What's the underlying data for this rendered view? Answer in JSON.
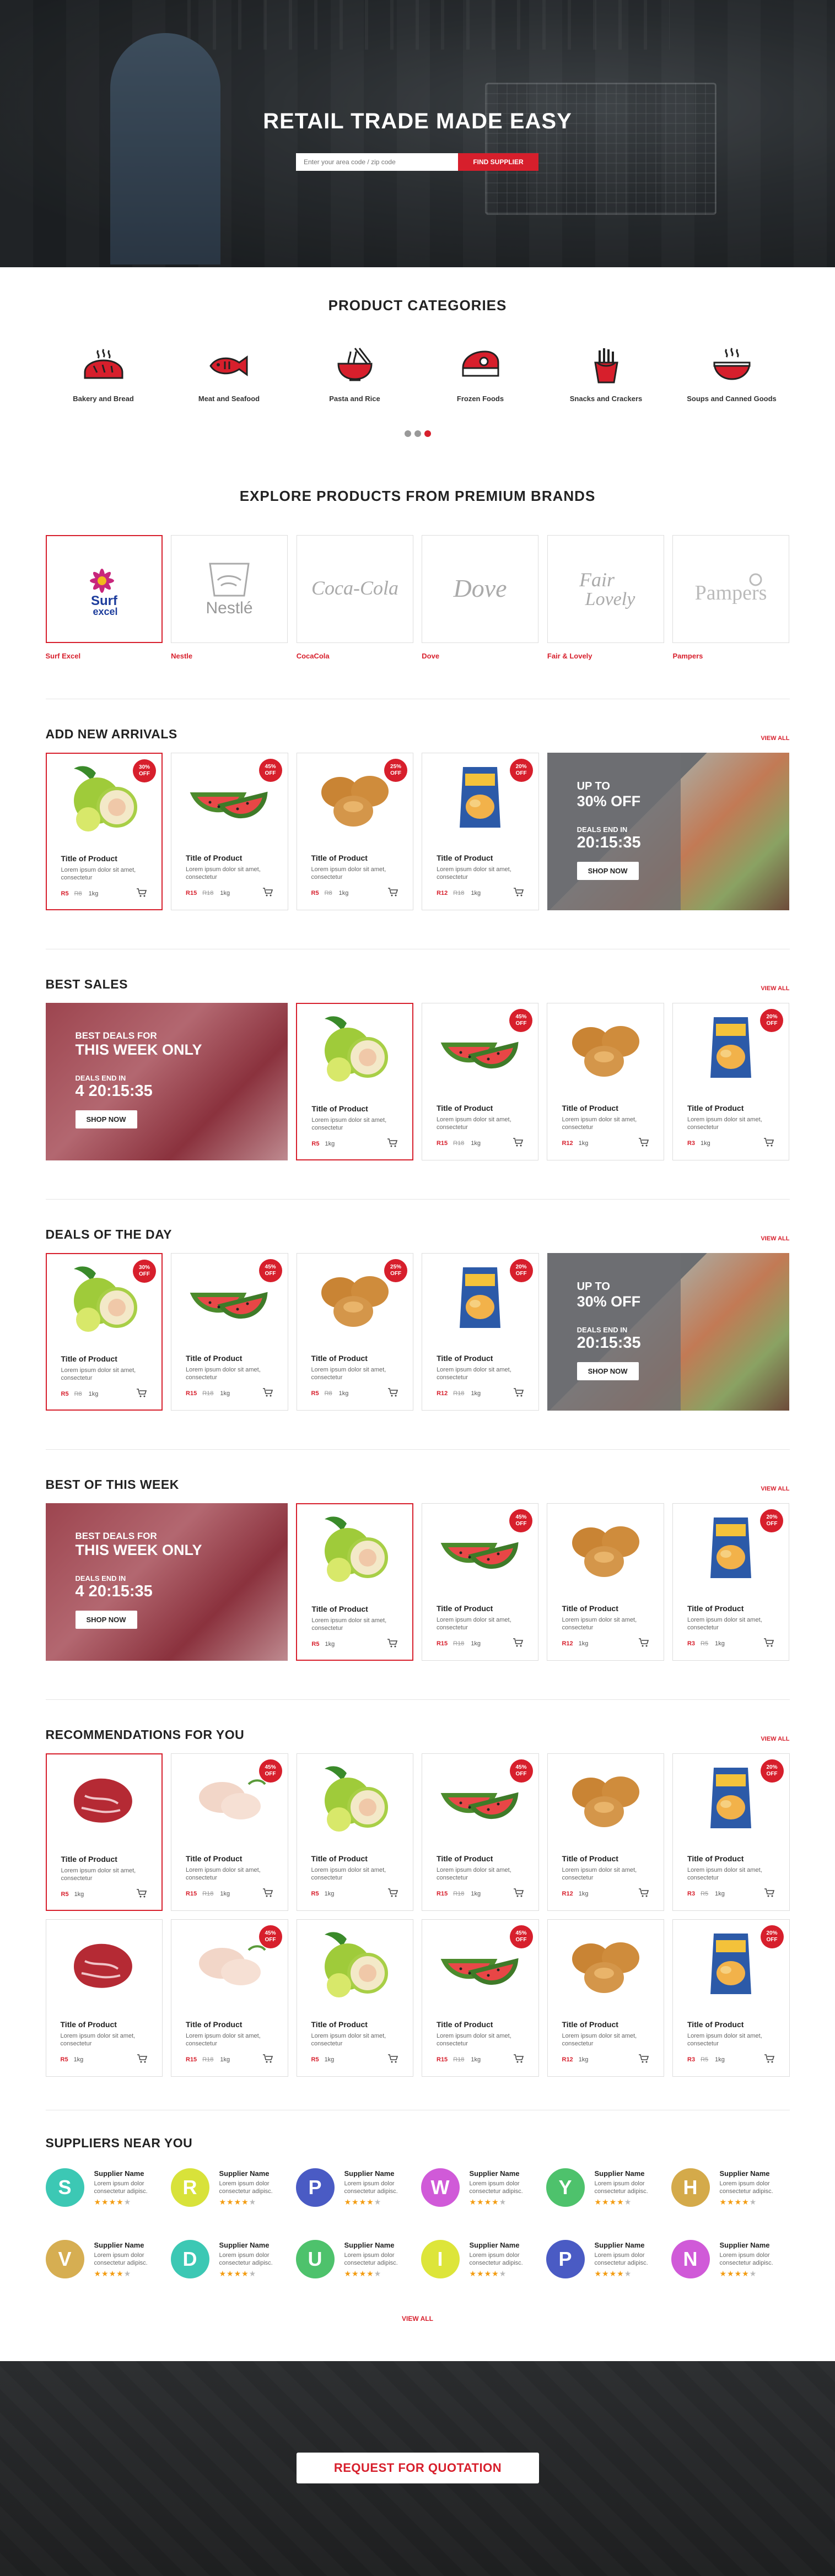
{
  "hero": {
    "title": "RETAIL TRADE MADE EASY",
    "search_placeholder": "Enter your area code / zip code",
    "search_button": "FIND SUPPLIER"
  },
  "categories": {
    "title": "PRODUCT CATEGORIES",
    "items": [
      {
        "label": "Bakery and Bread",
        "icon": "bread-icon"
      },
      {
        "label": "Meat and Seafood",
        "icon": "fish-icon"
      },
      {
        "label": "Pasta and Rice",
        "icon": "noodles-icon"
      },
      {
        "label": "Frozen Foods",
        "icon": "frozen-meat-icon"
      },
      {
        "label": "Snacks and Crackers",
        "icon": "fries-icon"
      },
      {
        "label": "Soups and Canned Goods",
        "icon": "soup-bowl-icon"
      }
    ]
  },
  "brands": {
    "title": "EXPLORE PRODUCTS FROM PREMIUM BRANDS",
    "items": [
      "Surf Excel",
      "Nestle",
      "CocaCola",
      "Dove",
      "Fair & Lovely",
      "Pampers"
    ],
    "logos": {
      "surf_a": "Surf",
      "surf_b": "excel",
      "nestle": "Nestlé",
      "coca": "Coca-Cola",
      "dove": "Dove",
      "fair_a": "Fair",
      "fair_b": "Lovely",
      "pampers": "Pampers"
    }
  },
  "common": {
    "title": "Title of Product",
    "desc": "Lorem ipsum dolor sit amet, consectetur",
    "weight": "1kg",
    "view_all": "VIEW ALL",
    "off": "OFF",
    "shop_now": "SHOP NOW"
  },
  "arrivals": {
    "title": "ADD NEW ARRIVALS",
    "products": [
      {
        "price": "R5",
        "old": "R8",
        "badge": "30%"
      },
      {
        "price": "R15",
        "old": "R18",
        "badge": "45%"
      },
      {
        "price": "R5",
        "old": "R8",
        "badge": "25%"
      },
      {
        "price": "R12",
        "old": "R18",
        "badge": "20%"
      }
    ],
    "promo": {
      "a": "UP TO",
      "b": "30% OFF",
      "c": "DEALS END IN",
      "e": "20:15:35"
    }
  },
  "best_sales": {
    "title": "BEST SALES",
    "promo": {
      "a": "BEST DEALS FOR",
      "b": "THIS WEEK ONLY",
      "c": "DEALS END IN",
      "e": "4  20:15:35"
    },
    "products": [
      {
        "price": "R5",
        "old": "",
        "badge": ""
      },
      {
        "price": "R15",
        "old": "R18",
        "badge": "45%"
      },
      {
        "price": "R12",
        "old": "",
        "badge": ""
      },
      {
        "price": "R3",
        "old": "",
        "badge": "20%"
      }
    ]
  },
  "deals": {
    "title": "DEALS OF THE DAY",
    "products": [
      {
        "price": "R5",
        "old": "R8",
        "badge": "30%"
      },
      {
        "price": "R15",
        "old": "R18",
        "badge": "45%"
      },
      {
        "price": "R5",
        "old": "R8",
        "badge": "25%"
      },
      {
        "price": "R12",
        "old": "R18",
        "badge": "20%"
      }
    ],
    "promo": {
      "a": "UP TO",
      "b": "30% OFF",
      "c": "DEALS END IN",
      "e": "20:15:35"
    }
  },
  "best_week": {
    "title": "BEST OF THIS WEEK",
    "promo": {
      "a": "BEST DEALS FOR",
      "b": "THIS WEEK ONLY",
      "c": "DEALS END IN",
      "e": "4  20:15:35"
    },
    "products": [
      {
        "price": "R5",
        "old": "",
        "badge": ""
      },
      {
        "price": "R15",
        "old": "R18",
        "badge": "45%"
      },
      {
        "price": "R12",
        "old": "",
        "badge": ""
      },
      {
        "price": "R3",
        "old": "R5",
        "badge": "20%"
      }
    ]
  },
  "recommend": {
    "title": "RECOMMENDATIONS FOR YOU",
    "rows": [
      [
        {
          "price": "R5",
          "old": "",
          "badge": ""
        },
        {
          "price": "R15",
          "old": "R18",
          "badge": "45%"
        },
        {
          "price": "R5",
          "old": "",
          "badge": ""
        },
        {
          "price": "R15",
          "old": "R18",
          "badge": "45%"
        },
        {
          "price": "R12",
          "old": "",
          "badge": ""
        },
        {
          "price": "R3",
          "old": "R5",
          "badge": "20%"
        }
      ],
      [
        {
          "price": "R5",
          "old": "",
          "badge": ""
        },
        {
          "price": "R15",
          "old": "R18",
          "badge": "45%"
        },
        {
          "price": "R5",
          "old": "",
          "badge": ""
        },
        {
          "price": "R15",
          "old": "R18",
          "badge": "45%"
        },
        {
          "price": "R12",
          "old": "",
          "badge": ""
        },
        {
          "price": "R3",
          "old": "R5",
          "badge": "20%"
        }
      ]
    ]
  },
  "suppliers": {
    "title": "SUPPLIERS NEAR YOU",
    "name": "Supplier Name",
    "desc": "Lorem ipsum dolor consectetur adipisc.",
    "view_all": "VIEW ALL",
    "items": [
      {
        "letter": "S",
        "color": "#3cc8b4",
        "rating": 4
      },
      {
        "letter": "R",
        "color": "#d8e23a",
        "rating": 4
      },
      {
        "letter": "P",
        "color": "#4a5bc4",
        "rating": 4
      },
      {
        "letter": "W",
        "color": "#d05ad8",
        "rating": 4
      },
      {
        "letter": "Y",
        "color": "#4ec26c",
        "rating": 4
      },
      {
        "letter": "H",
        "color": "#d4aa4a",
        "rating": 4
      },
      {
        "letter": "V",
        "color": "#d6ae52",
        "rating": 4
      },
      {
        "letter": "D",
        "color": "#3cc8b4",
        "rating": 4
      },
      {
        "letter": "U",
        "color": "#4ec26c",
        "rating": 4
      },
      {
        "letter": "I",
        "color": "#dde53a",
        "rating": 4
      },
      {
        "letter": "P",
        "color": "#4a5bc4",
        "rating": 4
      },
      {
        "letter": "N",
        "color": "#d05ad8",
        "rating": 4
      }
    ]
  },
  "footer": {
    "button": "REQUEST FOR QUOTATION"
  },
  "colors": {
    "accent": "#d71f2c"
  }
}
